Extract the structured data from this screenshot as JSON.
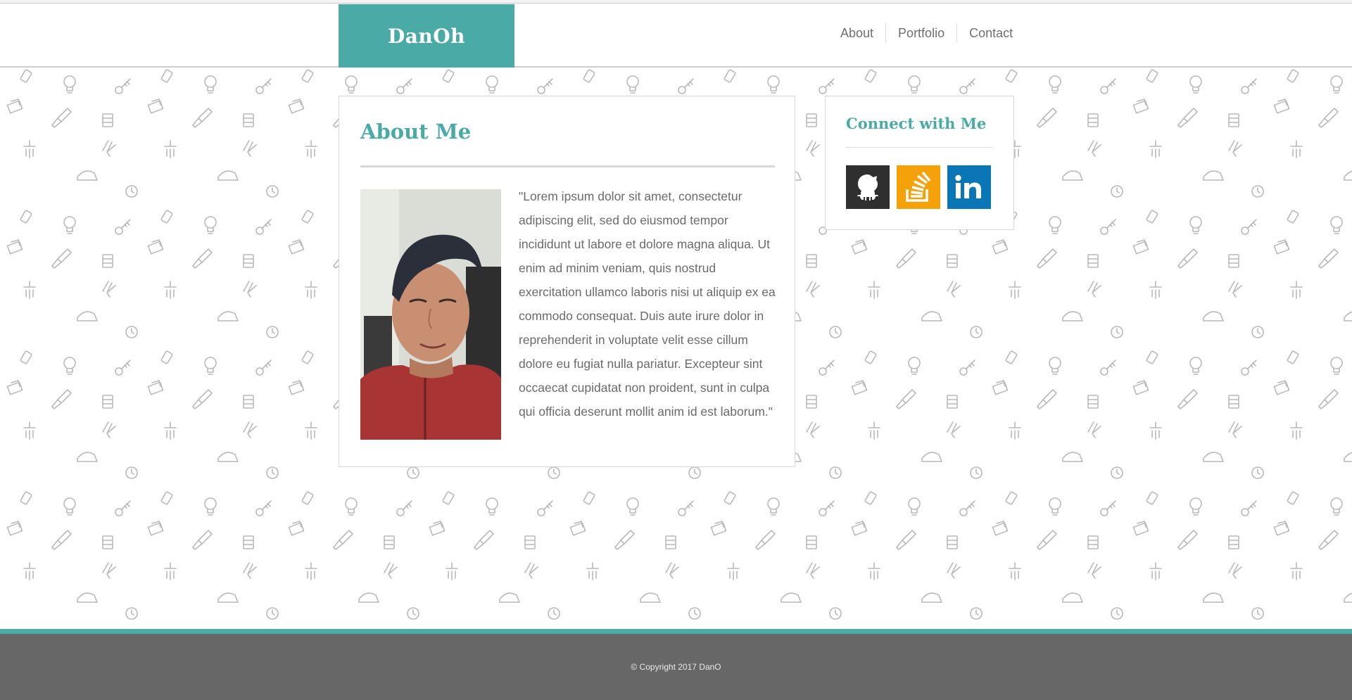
{
  "header": {
    "brand": "DanOh",
    "nav": [
      "About",
      "Portfolio",
      "Contact"
    ]
  },
  "about": {
    "title": "About Me",
    "text": "\"Lorem ipsum dolor sit amet, consectetur adipiscing elit, sed do eiusmod tempor incididunt ut labore et dolore magna aliqua. Ut enim ad minim veniam, quis nostrud exercitation ullamco laboris nisi ut aliquip ex ea commodo consequat. Duis aute irure dolor in reprehenderit in voluptate velit esse cillum dolore eu fugiat nulla pariatur. Excepteur sint occaecat cupidatat non proident, sunt in culpa qui officia deserunt mollit anim id est laborum.\""
  },
  "connect": {
    "title": "Connect with Me",
    "links": [
      {
        "icon": "github-icon",
        "color": "#2f2f2f"
      },
      {
        "icon": "stackoverflow-icon",
        "color": "#f5a10a"
      },
      {
        "icon": "linkedin-icon",
        "color": "#0b76b5"
      }
    ]
  },
  "footer": {
    "copyright": "© Copyright 2017 DanO"
  },
  "colors": {
    "accent": "#4aaba6",
    "footer": "#676767",
    "text": "#6a6a6a"
  }
}
